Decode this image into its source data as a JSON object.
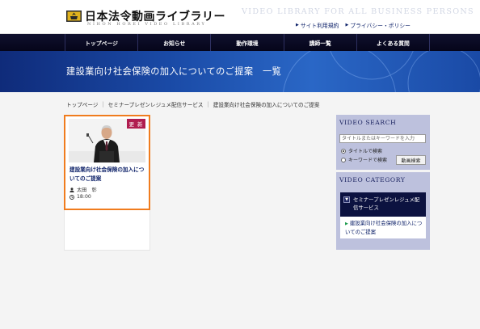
{
  "header": {
    "logo_title": "日本法令動画ライブラリー",
    "logo_sub": "NIHON HOREI VIDEO LIBRARY",
    "tagline": "VIDEO LIBRARY FOR ALL BUSINESS PERSONS",
    "util_links": [
      "サイト利用規約",
      "プライバシー・ポリシー"
    ]
  },
  "nav": {
    "items": [
      "トップページ",
      "お知らせ",
      "動作環境",
      "講師一覧",
      "よくある質問"
    ]
  },
  "banner": {
    "title": "建設業向け社会保険の加入についてのご提案　一覧"
  },
  "breadcrumb": [
    "トップページ",
    "セミナープレゼンレジュメ配信サービス",
    "建設業向け社会保険の加入についてのご提案"
  ],
  "video": {
    "badge": "更 新",
    "title": "建設業向け社会保険の加入についてのご提案",
    "presenter": "太田　彰",
    "duration": "18:00"
  },
  "search": {
    "heading": "VIDEO SEARCH",
    "placeholder": "タイトルまたはキーワードを入力",
    "options": [
      "タイトルで検索",
      "キーワードで検索"
    ],
    "selected_option": "タイトルで検索",
    "button": "動画検索"
  },
  "category": {
    "heading": "VIDEO CATEGORY",
    "group": "セミナープレゼンレジュメ配信サービス",
    "items": [
      "建設業向け社会保険の加入についてのご提案"
    ]
  },
  "colors": {
    "nav_bg": "#0a0b24",
    "banner": "#1a4aa6",
    "card_border": "#f07c1e",
    "badge": "#b01c4f",
    "link": "#0c2068",
    "sidebar_bg": "#bdc1dd"
  }
}
